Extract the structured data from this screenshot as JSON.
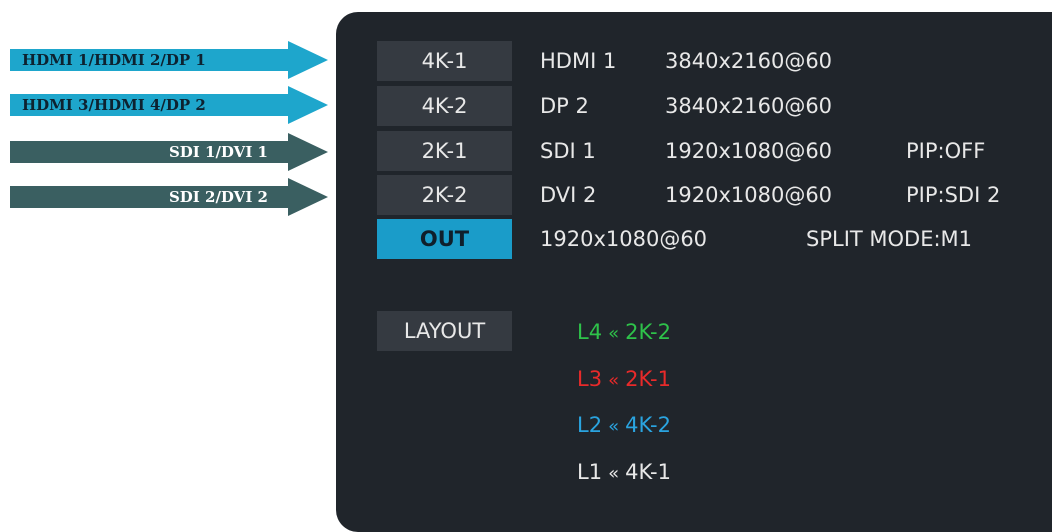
{
  "arrows": [
    {
      "label": "HDMI 1/HDMI 2/DP 1"
    },
    {
      "label": "HDMI 3/HDMI 4/DP 2"
    },
    {
      "label": "SDI 1/DVI 1"
    },
    {
      "label": "SDI 2/DVI 2"
    }
  ],
  "rows": [
    {
      "name": "4K-1",
      "source": "HDMI 1",
      "resolution": "3840x2160@60",
      "pip": ""
    },
    {
      "name": "4K-2",
      "source": "DP 2",
      "resolution": "3840x2160@60",
      "pip": ""
    },
    {
      "name": "2K-1",
      "source": "SDI 1",
      "resolution": "1920x1080@60",
      "pip": "PIP:OFF"
    },
    {
      "name": "2K-2",
      "source": "DVI 2",
      "resolution": "1920x1080@60",
      "pip": "PIP:SDI 2"
    }
  ],
  "output": {
    "label": "OUT",
    "resolution": "1920x1080@60",
    "mode": "SPLIT MODE:M1"
  },
  "layout": {
    "label": "LAYOUT",
    "chevron": "«",
    "layers": [
      {
        "layer": "L4",
        "source": "2K-2",
        "color": "#2ec24a"
      },
      {
        "layer": "L3",
        "source": "2K-1",
        "color": "#e82a2a"
      },
      {
        "layer": "L2",
        "source": "4K-2",
        "color": "#2aa4e0"
      },
      {
        "layer": "L1",
        "source": "4K-1",
        "color": "#e8e8e8"
      }
    ]
  }
}
